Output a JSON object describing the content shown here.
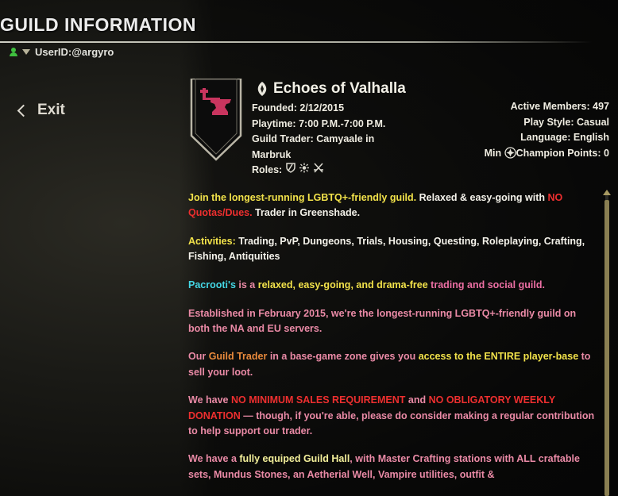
{
  "header": {
    "title": "GUILD INFORMATION",
    "user_id": "UserID:@argyro"
  },
  "nav": {
    "exit_label": "Exit"
  },
  "guild": {
    "name": "Echoes of Valhalla",
    "founded_label": "Founded:",
    "founded": "2/12/2015",
    "playtime_label": "Playtime:",
    "playtime": "7:00 P.M.-7:00 P.M.",
    "trader_label": "Guild Trader:",
    "trader_line1": "Camyaale in",
    "trader_line2": "Marbruk",
    "roles_label": "Roles:",
    "roles": [
      "tank-icon",
      "healer-icon",
      "dps-icon"
    ],
    "active_members_label": "Active Members:",
    "active_members": "497",
    "play_style_label": "Play Style:",
    "play_style": "Casual",
    "language_label": "Language:",
    "language": "English",
    "min_cp_label_pre": "Min",
    "min_cp_label_post": "Champion Points:",
    "min_cp": "0"
  },
  "description": {
    "p1": [
      {
        "text": "Join the longest-running LGBTQ+-friendly guild. ",
        "color": "yellow"
      },
      {
        "text": "Relaxed & easy-going with ",
        "color": "white"
      },
      {
        "text": "NO Quotas/Dues.",
        "color": "red"
      },
      {
        "text": " Trader in Greenshade.",
        "color": "white"
      }
    ],
    "p2": [
      {
        "text": "Activities: ",
        "color": "yellow"
      },
      {
        "text": "Trading, PvP, Dungeons, Trials, Housing, Questing, Roleplaying, Crafting, Fishing, Antiquities",
        "color": "white"
      }
    ],
    "p3": [
      {
        "text": "Pacrooti's",
        "color": "cyan"
      },
      {
        "text": " is a ",
        "color": "salmon"
      },
      {
        "text": "relaxed, easy-going, and drama-free",
        "color": "yellow"
      },
      {
        "text": " trading and social guild.",
        "color": "pink"
      }
    ],
    "p4": [
      {
        "text": "Established in February 2015, we're the longest-running LGBTQ+-friendly guild on both the NA and EU servers.",
        "color": "salmon"
      }
    ],
    "p5": [
      {
        "text": "Our ",
        "color": "salmon"
      },
      {
        "text": "Guild Trader",
        "color": "orange"
      },
      {
        "text": " in a base-game zone gives you ",
        "color": "salmon"
      },
      {
        "text": "access to the ENTIRE player-base",
        "color": "yellow"
      },
      {
        "text": " to sell your loot.",
        "color": "salmon"
      }
    ],
    "p6": [
      {
        "text": "We have ",
        "color": "salmon"
      },
      {
        "text": "NO MINIMUM SALES REQUIREMENT",
        "color": "red"
      },
      {
        "text": " and ",
        "color": "salmon"
      },
      {
        "text": "NO OBLIGATORY WEEKLY DONATION",
        "color": "red"
      },
      {
        "text": " — though, if you're able, please do consider making a regular contribution to help support our trader.",
        "color": "salmon"
      }
    ],
    "p7": [
      {
        "text": "We have a ",
        "color": "salmon"
      },
      {
        "text": "fully equiped Guild Hall",
        "color": "lightyellow"
      },
      {
        "text": ", with Master Crafting stations with ALL craftable sets, Mundus Stones, an Aetherial Well, Vampire utilities, outfit &",
        "color": "salmon"
      }
    ]
  },
  "colors": {
    "yellow": "#f2e24a",
    "white": "#f4f2ea",
    "red": "#ee2f2f",
    "cyan": "#44d6e4",
    "orange": "#e98a3c",
    "pink": "#ec6fa3",
    "salmon": "#ea8aa6",
    "lightyellow": "#f3ef9a",
    "user_icon": "#3fbf3f",
    "heraldry_field": "#0c0c0c",
    "heraldry_emblem": "#c9355f"
  }
}
